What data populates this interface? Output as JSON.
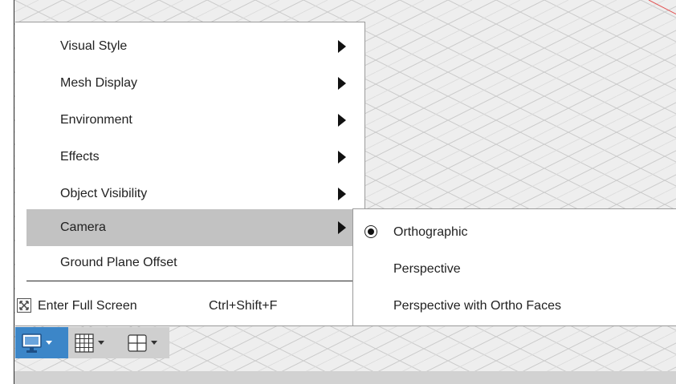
{
  "menu": {
    "items": [
      {
        "label": "Visual Style",
        "has_submenu": true
      },
      {
        "label": "Mesh Display",
        "has_submenu": true
      },
      {
        "label": "Environment",
        "has_submenu": true
      },
      {
        "label": "Effects",
        "has_submenu": true
      },
      {
        "label": "Object Visibility",
        "has_submenu": true
      },
      {
        "label": "Camera",
        "has_submenu": true,
        "active": true
      },
      {
        "label": "Ground Plane Offset",
        "has_submenu": false
      }
    ],
    "full_screen": {
      "label": "Enter Full Screen",
      "shortcut": "Ctrl+Shift+F",
      "icon": "fullscreen-icon"
    }
  },
  "camera_submenu": {
    "items": [
      {
        "label": "Orthographic",
        "selected": true
      },
      {
        "label": "Perspective",
        "selected": false
      },
      {
        "label": "Perspective with Ortho Faces",
        "selected": false
      }
    ]
  },
  "toolbar": {
    "buttons": [
      {
        "icon": "display-settings-icon",
        "active": true
      },
      {
        "icon": "grid-snaps-icon",
        "active": false
      },
      {
        "icon": "viewports-icon",
        "active": false
      }
    ]
  },
  "colors": {
    "active_menu_bg": "#c2c2c2",
    "toolbar_active": "#3c86c8",
    "viewport_bg": "#eeeeee"
  }
}
